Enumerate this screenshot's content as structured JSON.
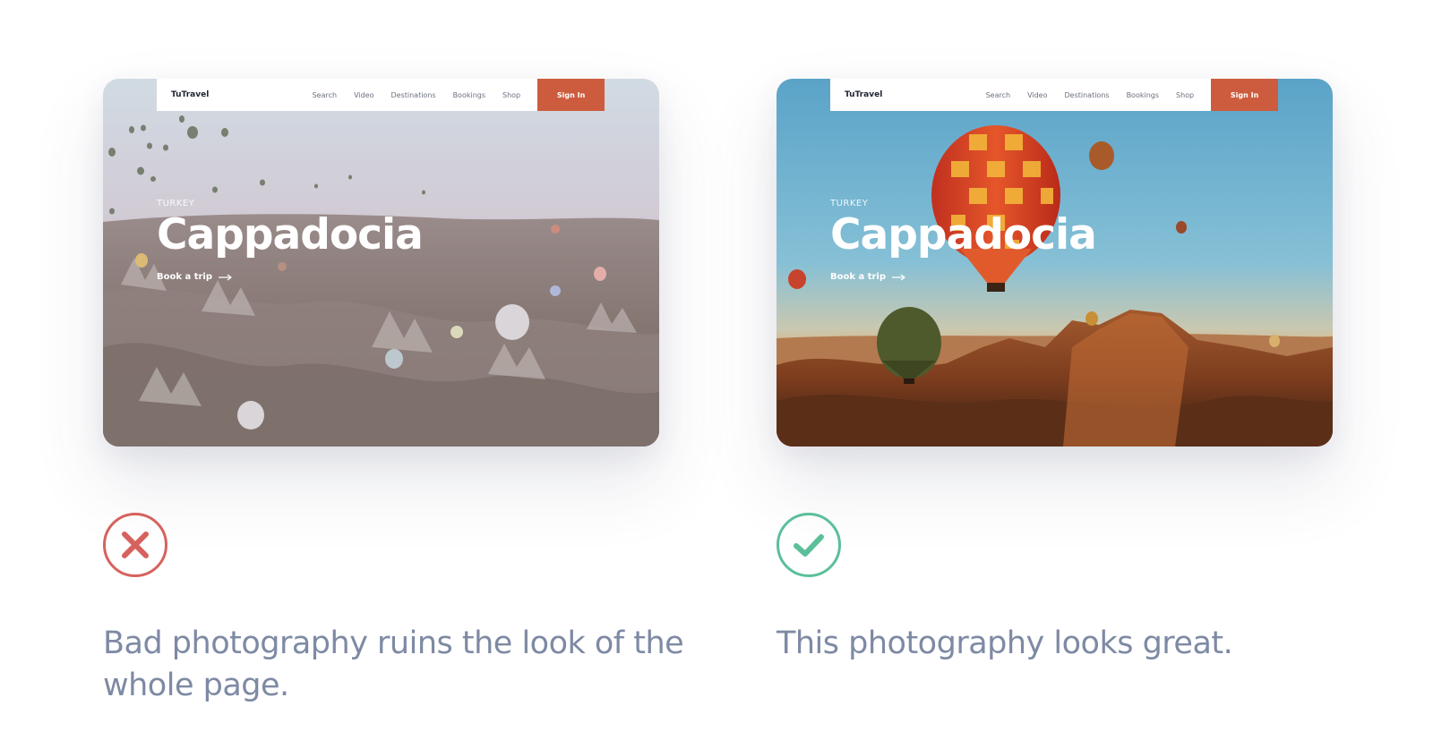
{
  "examples": [
    {
      "id": "bad",
      "site": {
        "brand": "TuTravel",
        "nav": [
          "Search",
          "Video",
          "Destinations",
          "Bookings",
          "Shop"
        ],
        "signin": "Sign In",
        "eyebrow": "TURKEY",
        "title": "Cappadocia",
        "cta": "Book a trip"
      },
      "verdict": "cross-icon",
      "caption": "Bad photography ruins the look of the whole page."
    },
    {
      "id": "good",
      "site": {
        "brand": "TuTravel",
        "nav": [
          "Search",
          "Video",
          "Destinations",
          "Bookings",
          "Shop"
        ],
        "signin": "Sign In",
        "eyebrow": "TURKEY",
        "title": "Cappadocia",
        "cta": "Book a trip"
      },
      "verdict": "check-icon",
      "caption": "This photography looks great."
    }
  ],
  "colors": {
    "signin_bg": "#cd5c3f",
    "bad": "#d6625e",
    "good": "#5cbf9a",
    "caption": "#7e8aa4"
  }
}
